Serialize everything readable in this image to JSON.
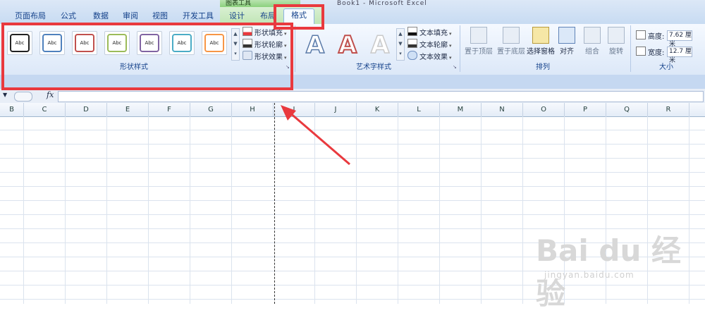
{
  "window": {
    "title": "Book1 - Microsoft Excel",
    "context_header": "图表工具"
  },
  "tabs": [
    {
      "label": "页面布局"
    },
    {
      "label": "公式"
    },
    {
      "label": "数据"
    },
    {
      "label": "审阅"
    },
    {
      "label": "视图"
    },
    {
      "label": "开发工具"
    },
    {
      "label": "设计"
    },
    {
      "label": "布局"
    },
    {
      "label": "格式",
      "active": true
    }
  ],
  "ribbon": {
    "shape_styles": {
      "label": "形状样式",
      "swatches": [
        {
          "text": "Abc",
          "color": "#222222"
        },
        {
          "text": "Abc",
          "color": "#4f81bd"
        },
        {
          "text": "Abc",
          "color": "#c0504d"
        },
        {
          "text": "Abc",
          "color": "#9bbb59"
        },
        {
          "text": "Abc",
          "color": "#8064a2"
        },
        {
          "text": "Abc",
          "color": "#4bacc6"
        },
        {
          "text": "Abc",
          "color": "#f79646"
        }
      ],
      "fill": "形状填充",
      "outline": "形状轮廓",
      "effect": "形状效果"
    },
    "wordart": {
      "label": "艺术字样式",
      "letters": [
        "A",
        "A",
        "A"
      ],
      "text_fill": "文本填充",
      "text_outline": "文本轮廓",
      "text_effect": "文本效果"
    },
    "arrange": {
      "label": "排列",
      "bring_front": "置于顶层",
      "send_back": "置于底层",
      "selection_pane": "选择窗格",
      "align": "对齐",
      "group": "组合",
      "rotate": "旋转"
    },
    "size": {
      "label": "大小",
      "height_label": "高度:",
      "height_value": "7.62 厘米",
      "width_label": "宽度:",
      "width_value": "12.7 厘米"
    }
  },
  "formula_bar": {
    "fx": "fx"
  },
  "columns": [
    "B",
    "C",
    "D",
    "E",
    "F",
    "G",
    "H",
    "I",
    "J",
    "K",
    "L",
    "M",
    "N",
    "O",
    "P",
    "Q",
    "R"
  ],
  "watermark": {
    "brand": "Bai du 经验",
    "url": "jingyan.baidu.com"
  },
  "annotation_color": "#e9393e"
}
